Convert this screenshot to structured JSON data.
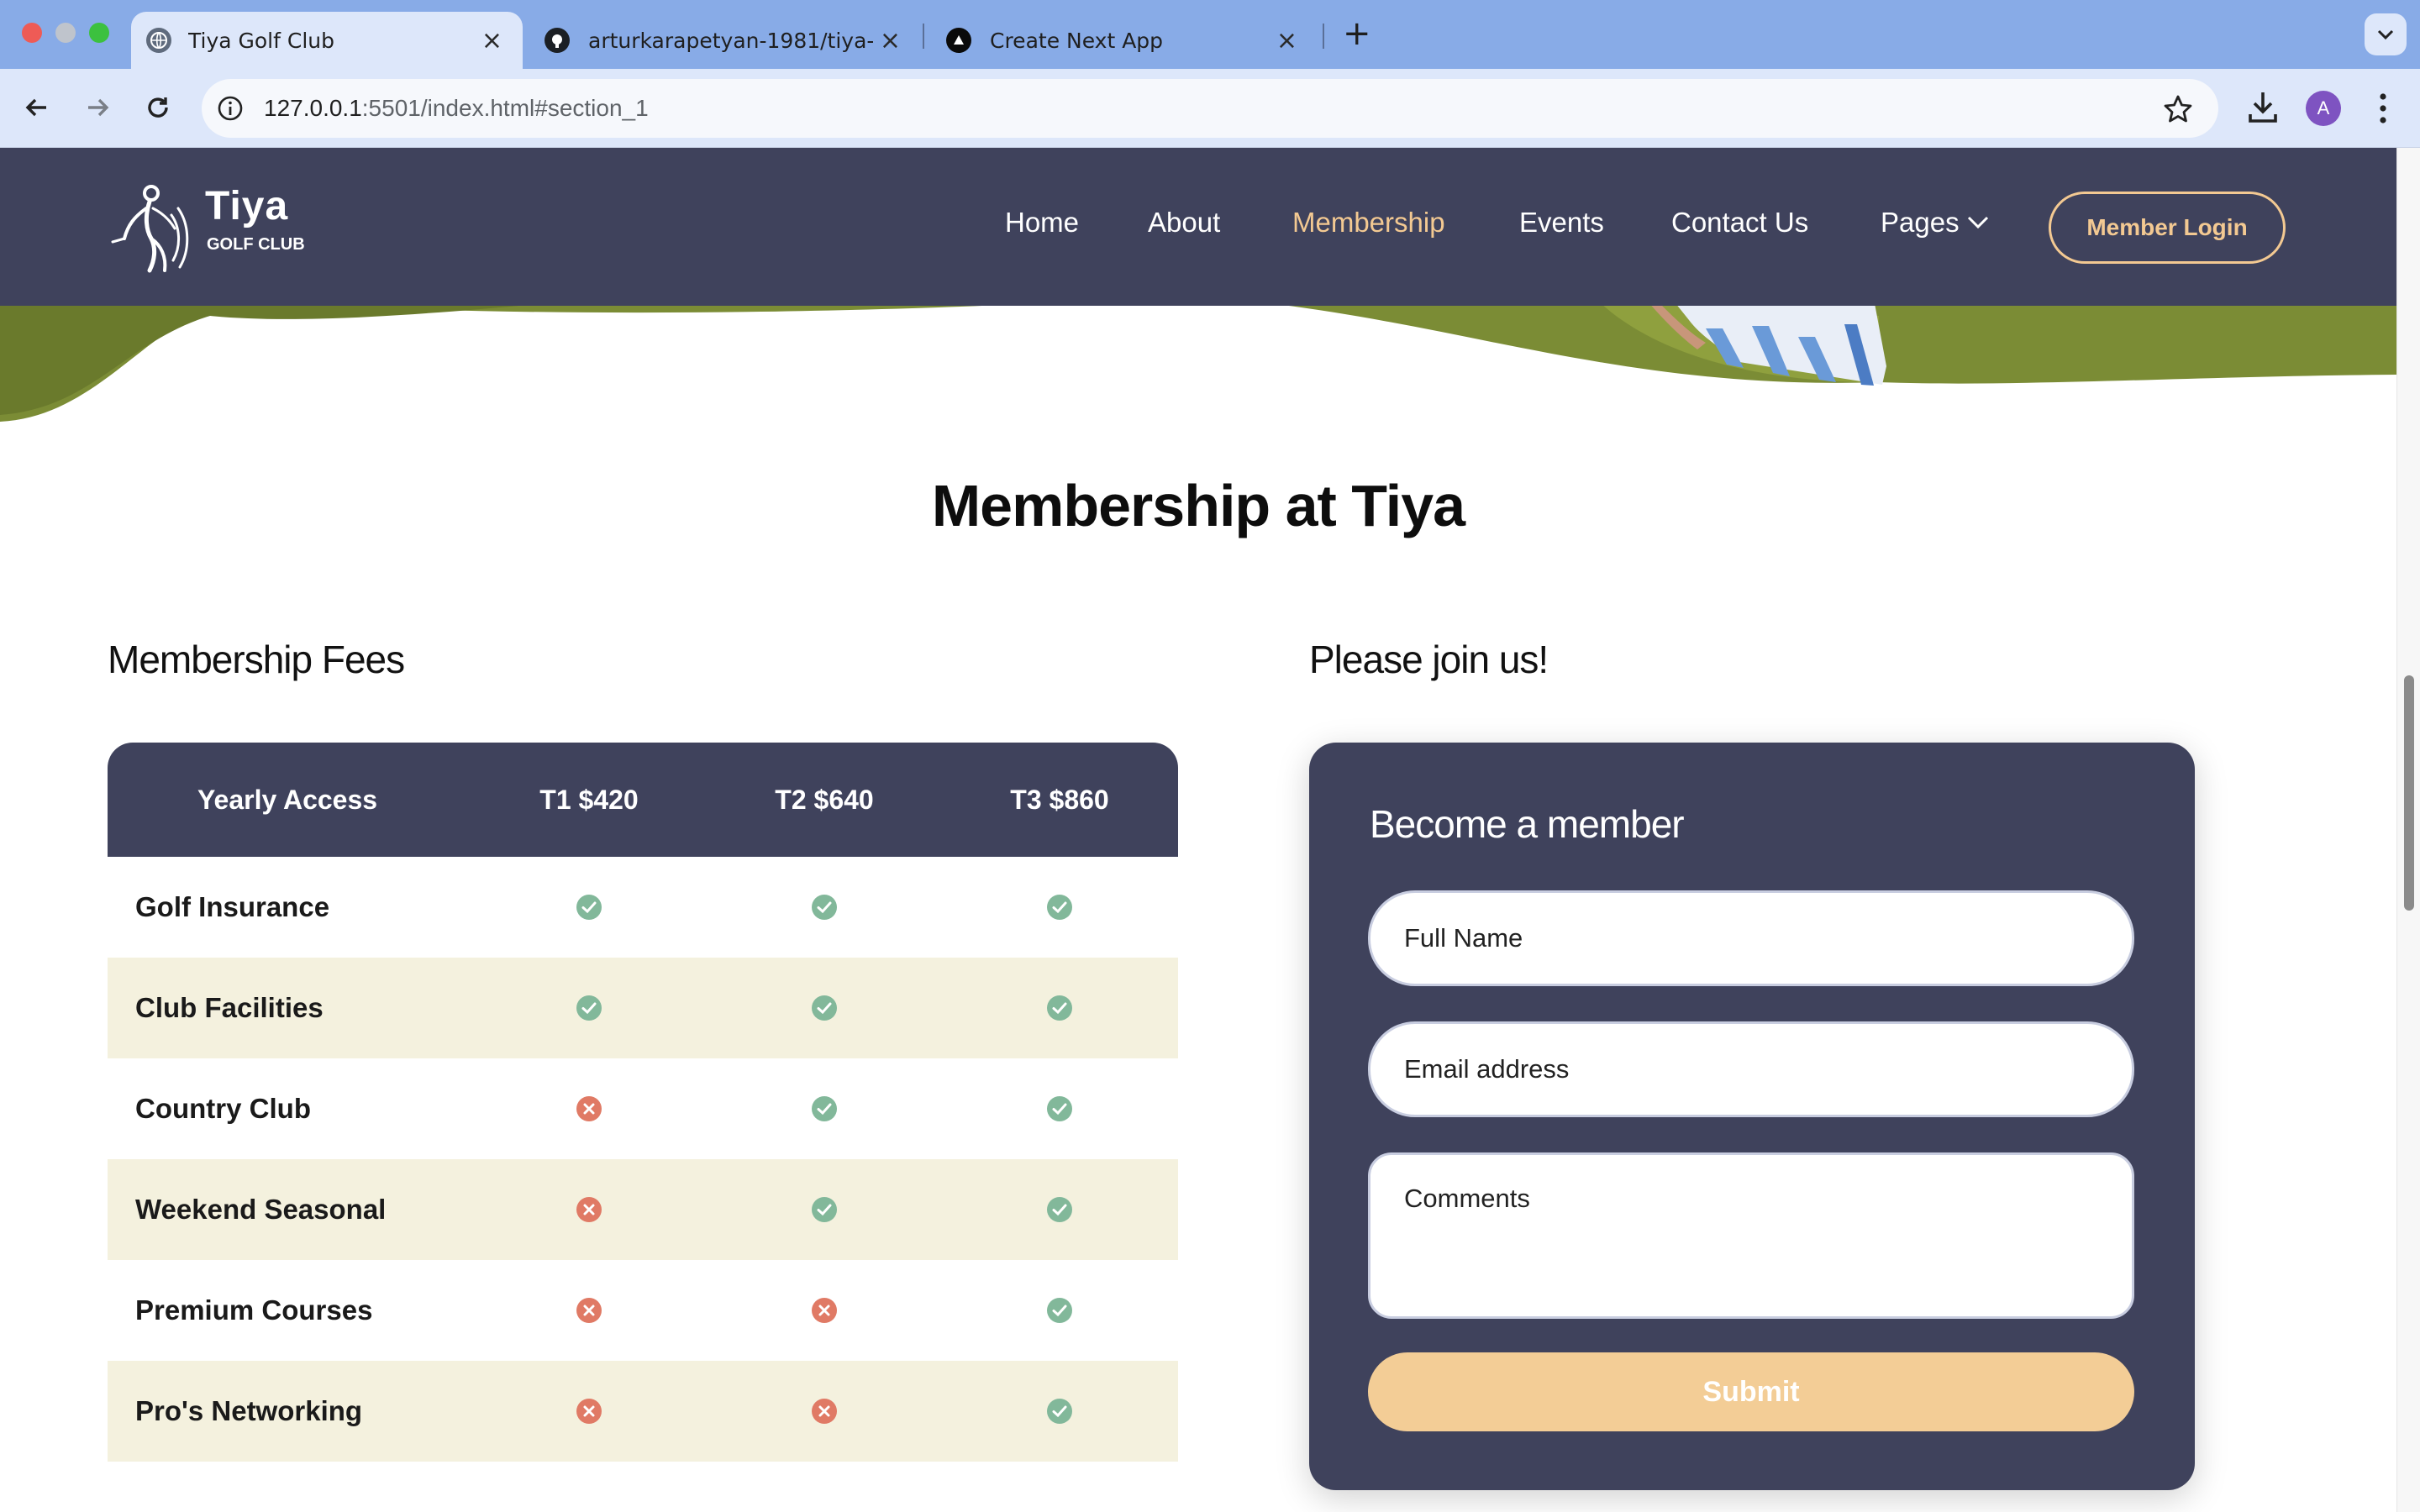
{
  "browser": {
    "tabs": [
      {
        "title": "Tiya Golf Club",
        "active": true
      },
      {
        "title": "arturkarapetyan-1981/tiya-golf",
        "active": false
      },
      {
        "title": "Create Next App",
        "active": false
      }
    ],
    "url_host": "127.0.0.1",
    "url_rest": ":5501/index.html#section_1",
    "profile_initial": "A"
  },
  "site": {
    "brand_name": "Tiya",
    "brand_sub": "GOLF CLUB",
    "nav": [
      "Home",
      "About",
      "Membership",
      "Events",
      "Contact Us",
      "Pages"
    ],
    "active_nav": "Membership",
    "login_label": "Member Login"
  },
  "main": {
    "title": "Membership at Tiya"
  },
  "fees": {
    "title": "Membership Fees",
    "headers": [
      "Yearly Access",
      "T1 $420",
      "T2 $640",
      "T3 $860"
    ],
    "rows": [
      {
        "label": "Golf Insurance",
        "t1": true,
        "t2": true,
        "t3": true
      },
      {
        "label": "Club Facilities",
        "t1": true,
        "t2": true,
        "t3": true
      },
      {
        "label": "Country Club",
        "t1": false,
        "t2": true,
        "t3": true
      },
      {
        "label": "Weekend Seasonal",
        "t1": false,
        "t2": true,
        "t3": true
      },
      {
        "label": "Premium Courses",
        "t1": false,
        "t2": false,
        "t3": true
      },
      {
        "label": "Pro's Networking",
        "t1": false,
        "t2": false,
        "t3": true
      }
    ]
  },
  "join": {
    "title": "Please join us!",
    "form_title": "Become a member",
    "name_placeholder": "Full Name",
    "email_placeholder": "Email address",
    "comments_placeholder": "Comments",
    "submit_label": "Submit"
  },
  "colors": {
    "header_bg": "#3f425c",
    "accent": "#f3c992",
    "row_shade": "#f4f1de",
    "check": "#82b89a",
    "cross": "#e07a65"
  }
}
